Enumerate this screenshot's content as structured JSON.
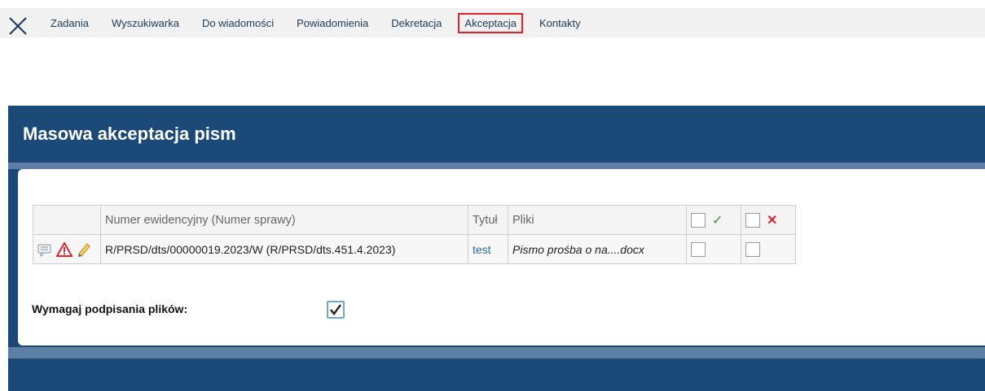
{
  "nav": {
    "items": [
      {
        "label": "Zadania"
      },
      {
        "label": "Wyszukiwarka"
      },
      {
        "label": "Do wiadomości"
      },
      {
        "label": "Powiadomienia"
      },
      {
        "label": "Dekretacja"
      },
      {
        "label": "Akceptacja",
        "active": true
      },
      {
        "label": "Kontakty"
      }
    ],
    "active_color": "#e0212b"
  },
  "panel": {
    "title": "Masowa akceptacja pism",
    "color": "#1b4a78"
  },
  "table": {
    "headers": {
      "number": "Numer ewidencyjny (Numer sprawy)",
      "title": "Tytuł",
      "files": "Pliki",
      "accept_icon": "check-icon",
      "reject_icon": "cross-icon"
    },
    "rows": [
      {
        "icons": [
          "comment-icon",
          "warning-icon",
          "pencil-icon"
        ],
        "number": "R/PRSD/dts/00000019.2023/W (R/PRSD/dts.451.4.2023)",
        "title": "test",
        "files": "Pismo prośba o na....docx",
        "accept_checked": false,
        "reject_checked": false
      }
    ]
  },
  "require_signing": {
    "label": "Wymagaj podpisania plików:",
    "checked": true
  }
}
